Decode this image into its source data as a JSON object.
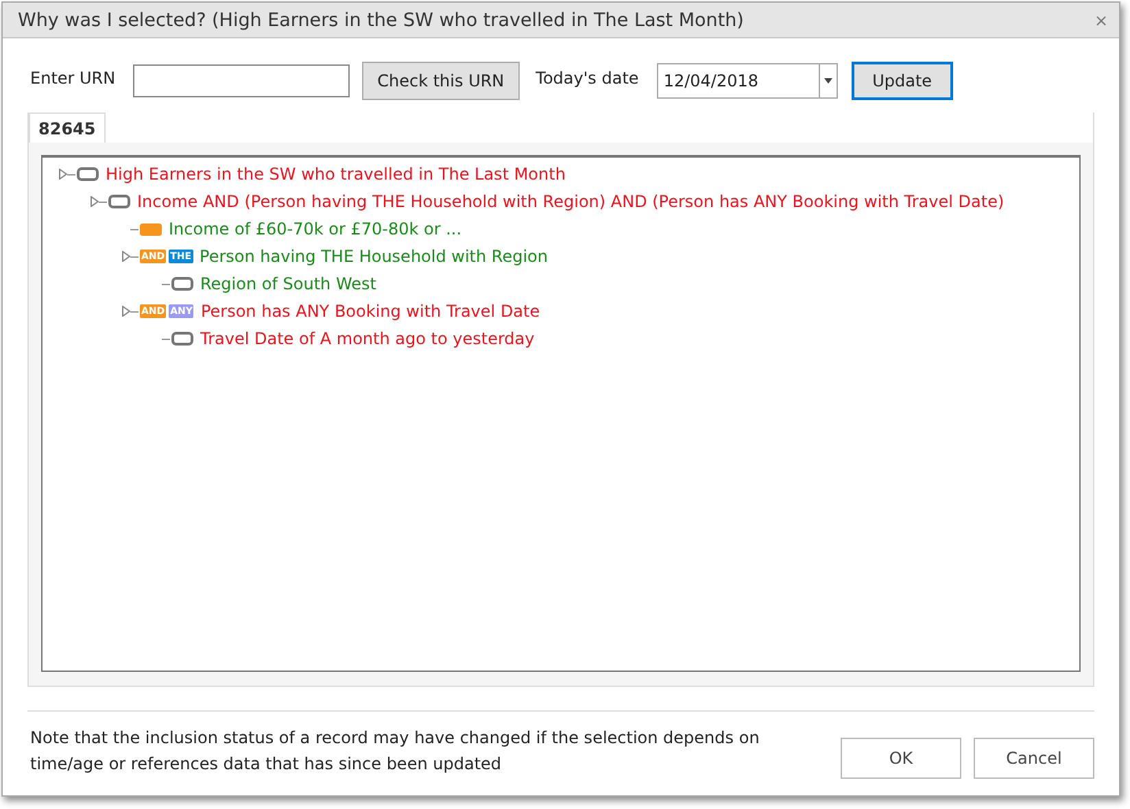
{
  "window": {
    "title": "Why was I selected? (High Earners in the SW who travelled in The Last Month)",
    "close": "×"
  },
  "form": {
    "urn_label": "Enter URN",
    "check_button": "Check this URN",
    "date_label": "Today's date",
    "date_value": "12/04/2018",
    "update_button": "Update"
  },
  "tabs": [
    {
      "label": "82645",
      "selected": true
    }
  ],
  "tree": [
    {
      "label": "High Earners in the SW who travelled in The Last Month",
      "color": "#e8141e",
      "kind": "bracket",
      "children": [
        {
          "label": "Income AND (Person having THE Household with Region) AND (Person has ANY Booking with Travel Date)",
          "color": "#e8141e",
          "kind": "bracket",
          "children": [
            {
              "label": "Income of £60-70k or £70-80k or ...",
              "color": "#1a8a1a",
              "kind": "block"
            },
            {
              "label": "Person having THE Household with Region",
              "color": "#1a8a1a",
              "kind": "badges",
              "badges": [
                {
                  "text": "AND",
                  "color": "#f7941d"
                },
                {
                  "text": "THE",
                  "color": "#0b8ad9"
                }
              ],
              "children": [
                {
                  "label": "Region of South West",
                  "color": "#1a8a1a",
                  "kind": "bracket"
                }
              ]
            },
            {
              "label": "Person has ANY Booking with Travel Date",
              "color": "#e8141e",
              "kind": "badges",
              "badges": [
                {
                  "text": "AND",
                  "color": "#f7941d"
                },
                {
                  "text": "ANY",
                  "color": "#9a9aee"
                }
              ],
              "children": [
                {
                  "label": "Travel Date of A month ago to yesterday",
                  "color": "#e8141e",
                  "kind": "bracket"
                }
              ]
            }
          ]
        }
      ]
    }
  ],
  "note": "Note that the inclusion status of a record may have changed if the selection depends on time/age or references data that has since been updated",
  "buttons": [
    "OK",
    "Cancel"
  ]
}
